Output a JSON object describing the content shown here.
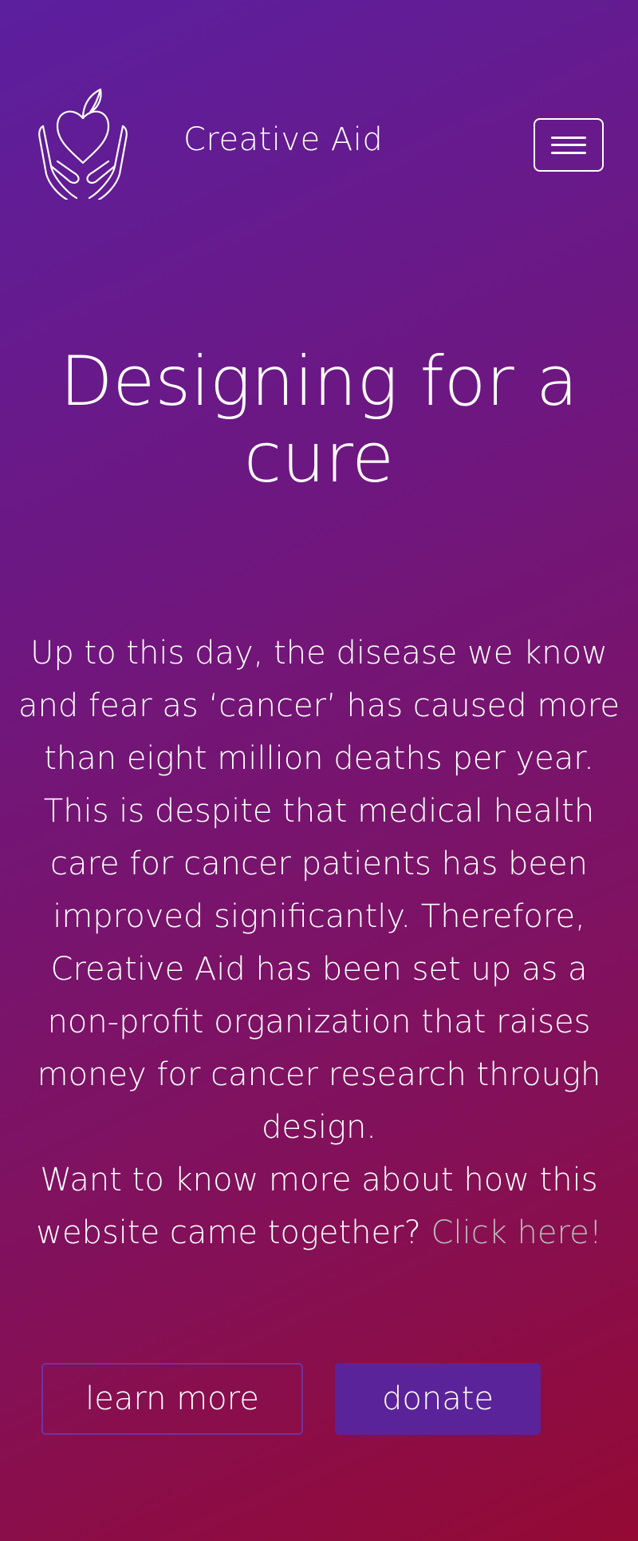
{
  "header": {
    "brand": "Creative Aid",
    "logo_icon": "heart-in-hands-icon",
    "menu_icon": "hamburger-menu-icon"
  },
  "hero": {
    "title": "Designing for a cure",
    "description": "Up to this day, the disease we know and fear as ‘cancer’ has caused more than eight million deaths per year. This is despite that medical health care for cancer patients has been improved significantly. Therefore, Creative Aid has been set up as a non-profit organization that raises money for cancer research through design.",
    "cta_text": "Want to know more about how this website came together?",
    "cta_link": "Click here!"
  },
  "buttons": {
    "learn_more": "learn more",
    "donate": "donate"
  },
  "colors": {
    "gradient_start": "#5c1f9f",
    "gradient_end": "#940a34",
    "donate_button": "#5b2399",
    "link_color": "#b9b9b9"
  }
}
